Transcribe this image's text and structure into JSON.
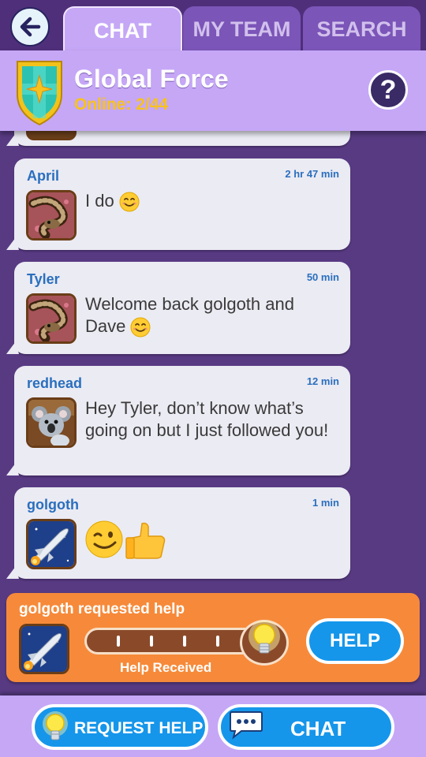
{
  "tabs": {
    "chat": "CHAT",
    "my_team": "MY TEAM",
    "search": "SEARCH"
  },
  "team": {
    "name": "Global Force",
    "online_label": "Online:",
    "online_count": "2/44"
  },
  "help_icon": "?",
  "messages": [
    {
      "sender": "April",
      "time": "2 hr 47 min",
      "text": "I do",
      "avatar": "snake-avatar",
      "emoji": "smile"
    },
    {
      "sender": "Tyler",
      "time": "50 min",
      "text": "Welcome back golgoth and Dave",
      "avatar": "snake-avatar",
      "emoji": "smile"
    },
    {
      "sender": "redhead",
      "time": "12 min",
      "text": "Hey Tyler, don’t know what’s going on but I just followed you!",
      "avatar": "koala-avatar"
    },
    {
      "sender": "golgoth",
      "time": "1 min",
      "text": "",
      "avatar": "shuttle-avatar",
      "emoji": "wink-thumbs-up"
    }
  ],
  "help_request": {
    "title": "golgoth requested help",
    "progress_label": "Help Received",
    "progress_fraction": 0,
    "button": "HELP"
  },
  "bottom": {
    "request_help": "REQUEST HELP",
    "chat": "CHAT"
  },
  "colors": {
    "background": "#583a83",
    "panel": "#c5a7f6",
    "accent_blue": "#1596ea",
    "help_card": "#f68a3a",
    "online_yellow": "#f7c21d",
    "name_blue": "#2a6fbe"
  }
}
